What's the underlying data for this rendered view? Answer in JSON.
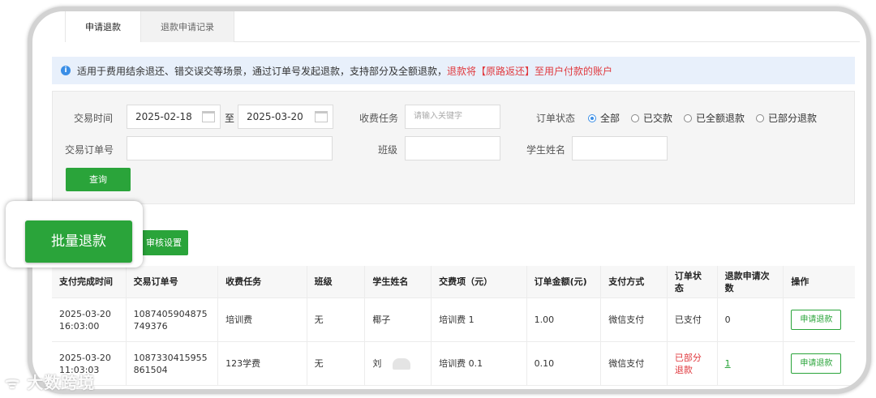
{
  "tabs": [
    {
      "label": "申请退款",
      "active": true
    },
    {
      "label": "退款申请记录",
      "active": false
    }
  ],
  "notice": {
    "icon": "info-icon",
    "text": "适用于费用结余退还、错交误交等场景，通过订单号发起退款，支持部分及全额退款，",
    "highlight": "退款将【原路返还】至用户付款的账户"
  },
  "filter": {
    "trade_time_label": "交易时间",
    "date_from": "2025-02-18",
    "date_to": "2025-03-20",
    "to_label": "至",
    "fee_task_label": "收费任务",
    "fee_task_placeholder": "请输入关键字",
    "order_status_label": "订单状态",
    "status_options": [
      "全部",
      "已交款",
      "已全额退款",
      "已部分退款"
    ],
    "status_selected": "全部",
    "order_no_label": "交易订单号",
    "class_label": "班级",
    "student_name_label": "学生姓名",
    "query_button": "查询"
  },
  "actions": {
    "batch_refund": "批量退款",
    "audit_settings": "审核设置"
  },
  "table": {
    "headers": [
      "支付完成时间",
      "交易订单号",
      "收费任务",
      "班级",
      "学生姓名",
      "交费项（元）",
      "订单金额(元)",
      "支付方式",
      "订单状态",
      "退款申请次数",
      "操作"
    ],
    "rows": [
      {
        "time": "2025-03-20 16:03:00",
        "order_no": "1087405904875749376",
        "task": "培训费",
        "class": "无",
        "student": "椰子",
        "item": "培训费 1",
        "amount": "1.00",
        "pay": "微信支付",
        "status": "已支付",
        "count": "0",
        "action": "申请退款"
      },
      {
        "time": "2025-03-20 11:03:03",
        "order_no": "1087330415955861504",
        "task": "123学费",
        "class": "无",
        "student": "刘",
        "item": "培训费 0.1",
        "amount": "0.10",
        "pay": "微信支付",
        "status": "已部分退款",
        "count": "1",
        "action": "申请退款"
      }
    ]
  },
  "watermark": "大数跨境",
  "colors": {
    "accent_green": "#2aa43a",
    "alert_red": "#e0393e",
    "info_blue": "#3a8ee6"
  }
}
